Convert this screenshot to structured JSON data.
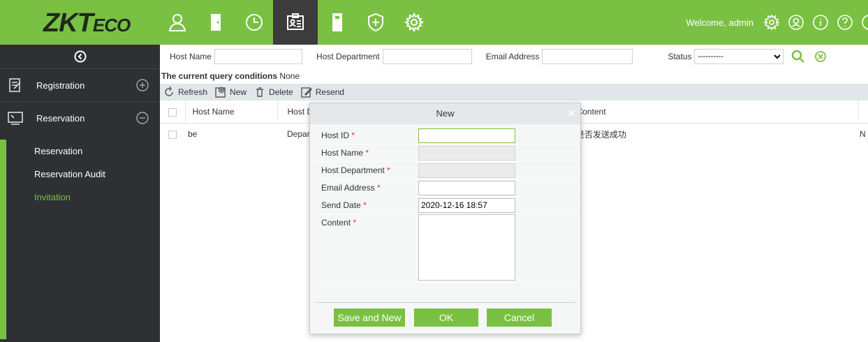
{
  "brand": {
    "logo_main": "ZKT",
    "logo_suffix": "ECO"
  },
  "topnav": {
    "modules": [
      "personnel-icon",
      "door-icon",
      "clock-icon",
      "visitor-card-icon",
      "device-icon",
      "shield-plus-icon",
      "gear-icon"
    ],
    "active_module": "visitor-card-icon"
  },
  "header": {
    "welcome": "Welcome, admin",
    "icons": [
      "settings-icon",
      "user-icon",
      "info-icon",
      "help-icon",
      "power-icon"
    ]
  },
  "sidebar": {
    "sections": [
      {
        "label": "Registration",
        "icon": "registration-icon",
        "toggle": "expand-icon"
      },
      {
        "label": "Reservation",
        "icon": "reservation-icon",
        "toggle": "collapse-icon"
      }
    ],
    "items": [
      {
        "label": "Reservation",
        "active": false
      },
      {
        "label": "Reservation Audit",
        "active": false
      },
      {
        "label": "Invitation",
        "active": true
      }
    ]
  },
  "filter": {
    "host_name_label": "Host Name",
    "host_department_label": "Host Department",
    "email_label": "Email Address",
    "status_label": "Status",
    "status_value": "----------"
  },
  "query": {
    "label": "The current query conditions",
    "value": "None"
  },
  "toolbar": {
    "refresh": "Refresh",
    "new": "New",
    "delete": "Delete",
    "resend": "Resend"
  },
  "table": {
    "columns": [
      "Host Name",
      "Host D",
      "Content"
    ],
    "rows": [
      {
        "host_name": "be",
        "host_department": "Departr",
        "content": "是否发送成功",
        "trailing": "N"
      }
    ]
  },
  "dialog": {
    "title": "New",
    "close": "×",
    "fields": [
      {
        "label": "Host ID",
        "required": "*",
        "value": ""
      },
      {
        "label": "Host Name",
        "required": "*",
        "value": ""
      },
      {
        "label": "Host Department",
        "required": "*",
        "value": ""
      },
      {
        "label": "Email Address",
        "required": "*",
        "value": ""
      },
      {
        "label": "Send Date",
        "required": "*",
        "value": "2020-12-16 18:57"
      },
      {
        "label": "Content",
        "required": "*",
        "value": ""
      }
    ],
    "buttons": {
      "save_new": "Save and New",
      "ok": "OK",
      "cancel": "Cancel"
    }
  },
  "colors": {
    "accent": "#7ac143",
    "sidebar_bg": "#2f3033",
    "active_nav_bg": "#3c3c3c"
  }
}
